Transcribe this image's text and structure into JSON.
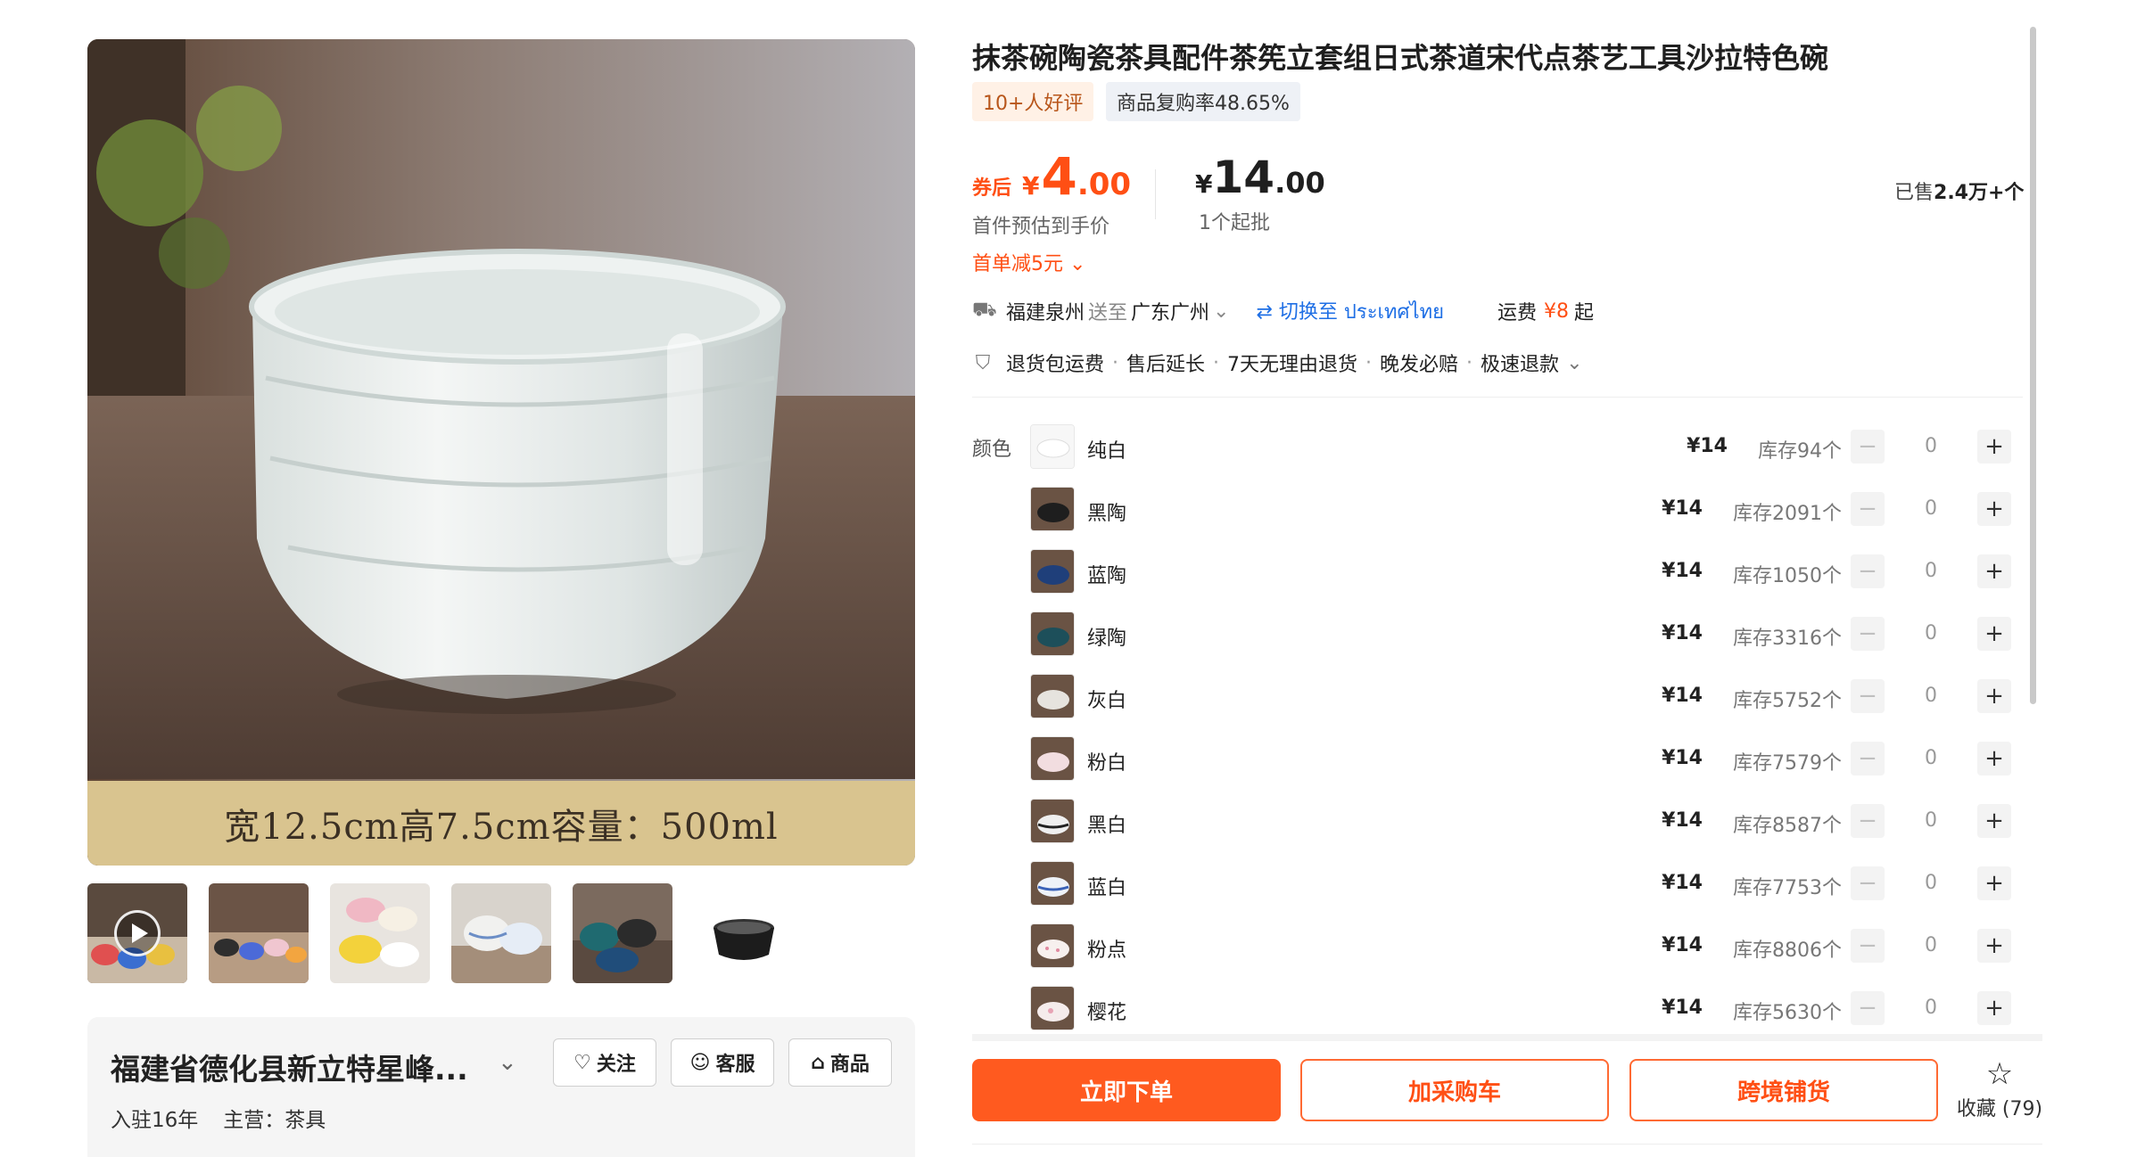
{
  "product": {
    "title": "抹茶碗陶瓷茶具配件茶筅立套组日式茶道宋代点茶艺工具沙拉特色碗",
    "image_caption": "宽12.5cm高7.5cm容量：500ml",
    "tags": [
      "10+人好评",
      "商品复购率48.65%"
    ]
  },
  "price": {
    "coupon_label": "券后",
    "coupon_currency": "¥",
    "coupon_int": "4",
    "coupon_dec": ".00",
    "coupon_sub": "首件预估到手价",
    "first_order": "首单减5元",
    "normal_currency": "¥",
    "normal_int": "14",
    "normal_dec": ".00",
    "min_order": "1个起批",
    "sold_prefix": "已售",
    "sold_value": "2.4万+个"
  },
  "shipping": {
    "from": "福建泉州",
    "to_label": "送至",
    "to": "广东广州",
    "switch_label": "切换至 ประเทศไทย",
    "fee_label": "运费",
    "fee_value": "¥8",
    "fee_suffix": "起"
  },
  "services": [
    "退货包运费",
    "售后延长",
    "7天无理由退货",
    "晚发必赔",
    "极速退款"
  ],
  "variants_label": "颜色",
  "variants": [
    {
      "name": "纯白",
      "price": "¥14",
      "stock": "库存94个",
      "qty": "0"
    },
    {
      "name": "黑陶",
      "price": "¥14",
      "stock": "库存2091个",
      "qty": "0"
    },
    {
      "name": "蓝陶",
      "price": "¥14",
      "stock": "库存1050个",
      "qty": "0"
    },
    {
      "name": "绿陶",
      "price": "¥14",
      "stock": "库存3316个",
      "qty": "0"
    },
    {
      "name": "灰白",
      "price": "¥14",
      "stock": "库存5752个",
      "qty": "0"
    },
    {
      "name": "粉白",
      "price": "¥14",
      "stock": "库存7579个",
      "qty": "0"
    },
    {
      "name": "黑白",
      "price": "¥14",
      "stock": "库存8587个",
      "qty": "0"
    },
    {
      "name": "蓝白",
      "price": "¥14",
      "stock": "库存7753个",
      "qty": "0"
    },
    {
      "name": "粉点",
      "price": "¥14",
      "stock": "库存8806个",
      "qty": "0"
    },
    {
      "name": "樱花",
      "price": "¥14",
      "stock": "库存5630个",
      "qty": "0"
    }
  ],
  "actions": {
    "buy_now": "立即下单",
    "add_cart": "加采购车",
    "cross_border": "跨境铺货",
    "favorite": "收藏 (79)"
  },
  "shop": {
    "name": "福建省德化县新立特星峰...",
    "follow": "关注",
    "service": "客服",
    "goods": "商品",
    "years": "入驻16年",
    "main_business": "主营：茶具"
  },
  "colors": {
    "accent": "#ff5a1f",
    "price_red": "#ff4f14",
    "link_blue": "#1f6fe5"
  }
}
